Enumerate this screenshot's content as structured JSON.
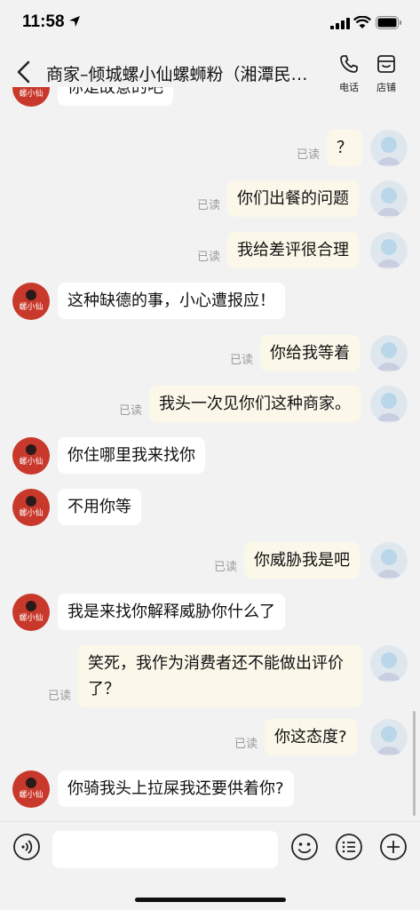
{
  "status": {
    "time": "11:58"
  },
  "nav": {
    "title": "商家–倾城螺小仙螺蛳粉（湘潭民主…",
    "phone_label": "电话",
    "shop_label": "店铺"
  },
  "brand": {
    "merchant_avatar_color": "#c8392b",
    "my_bubble_color": "#fbf8ea"
  },
  "messages": [
    {
      "side": "left",
      "text": "你是故意的吧"
    },
    {
      "side": "right",
      "text": "？",
      "status": "已读"
    },
    {
      "side": "right",
      "text": "你们出餐的问题",
      "status": "已读"
    },
    {
      "side": "right",
      "text": "我给差评很合理",
      "status": "已读"
    },
    {
      "side": "left",
      "text": "这种缺德的事，小心遭报应！"
    },
    {
      "side": "right",
      "text": "你给我等着",
      "status": "已读"
    },
    {
      "side": "right",
      "text": "我头一次见你们这种商家。",
      "status": "已读"
    },
    {
      "side": "left",
      "text": "你住哪里我来找你"
    },
    {
      "side": "left",
      "text": "不用你等"
    },
    {
      "side": "right",
      "text": "你威胁我是吧",
      "status": "已读"
    },
    {
      "side": "left",
      "text": "我是来找你解释威胁你什么了"
    },
    {
      "side": "right",
      "text": "笑死，我作为消费者还不能做出评价了？",
      "status": "已读"
    },
    {
      "side": "right",
      "text": "你这态度?",
      "status": "已读"
    },
    {
      "side": "left",
      "text": "你骑我头上拉屎我还要供着你?"
    }
  ],
  "input": {
    "value": "",
    "placeholder": ""
  }
}
